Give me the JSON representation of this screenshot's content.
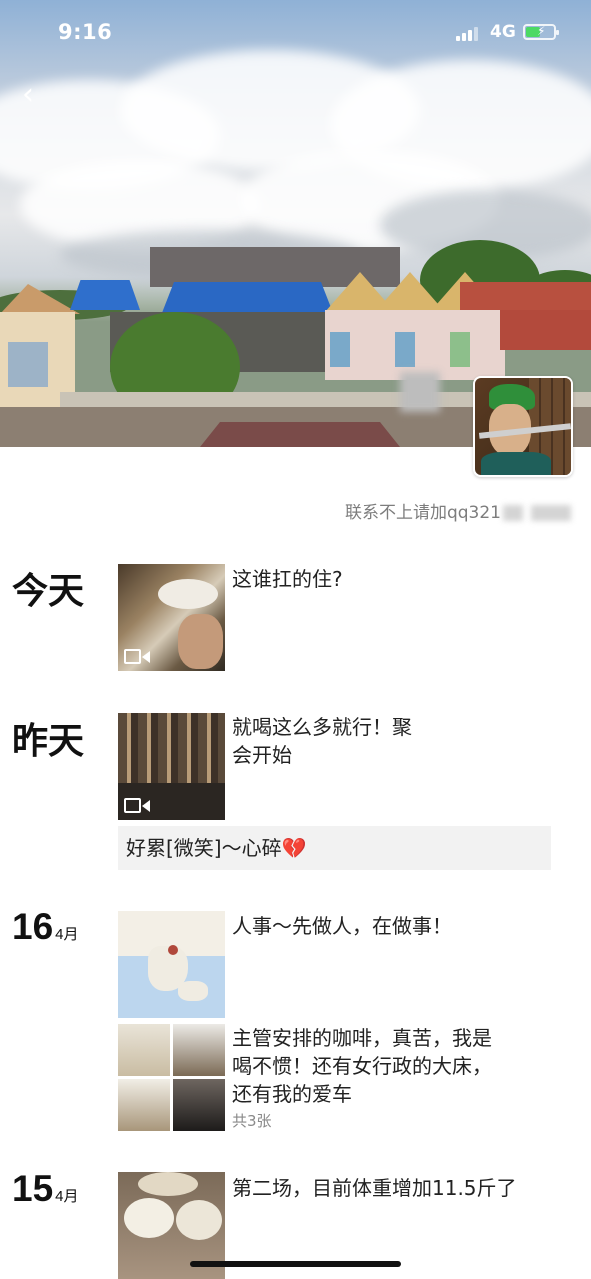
{
  "status_bar": {
    "time": "9:16",
    "network": "4G",
    "battery_color": "#4cd964"
  },
  "nav": {
    "back_icon": "chevron-left-icon",
    "back_glyph": "‹"
  },
  "profile": {
    "signature_prefix": "联系不上请加qq321"
  },
  "feed": [
    {
      "date_label": "今天",
      "text": "这谁扛的住?",
      "media": "video"
    },
    {
      "date_label": "昨天",
      "text_lines": [
        "就喝这么多就行！聚",
        "会开始"
      ],
      "media": "video",
      "share_text": "好累[微笑]～心碎",
      "share_emoji": "💔"
    },
    {
      "date_day": "16",
      "date_month": "4月",
      "posts": [
        {
          "text": "人事～先做人，在做事！",
          "media": "map"
        },
        {
          "text_lines": [
            "主管安排的咖啡，真苦，我是",
            "喝不惯！还有女行政的大床，",
            "还有我的爱车"
          ],
          "media": "photos",
          "photo_count": "共3张"
        }
      ]
    },
    {
      "date_day": "15",
      "date_month": "4月",
      "text": "第二场，目前体重增加11.5斤了",
      "media": "photo"
    }
  ]
}
